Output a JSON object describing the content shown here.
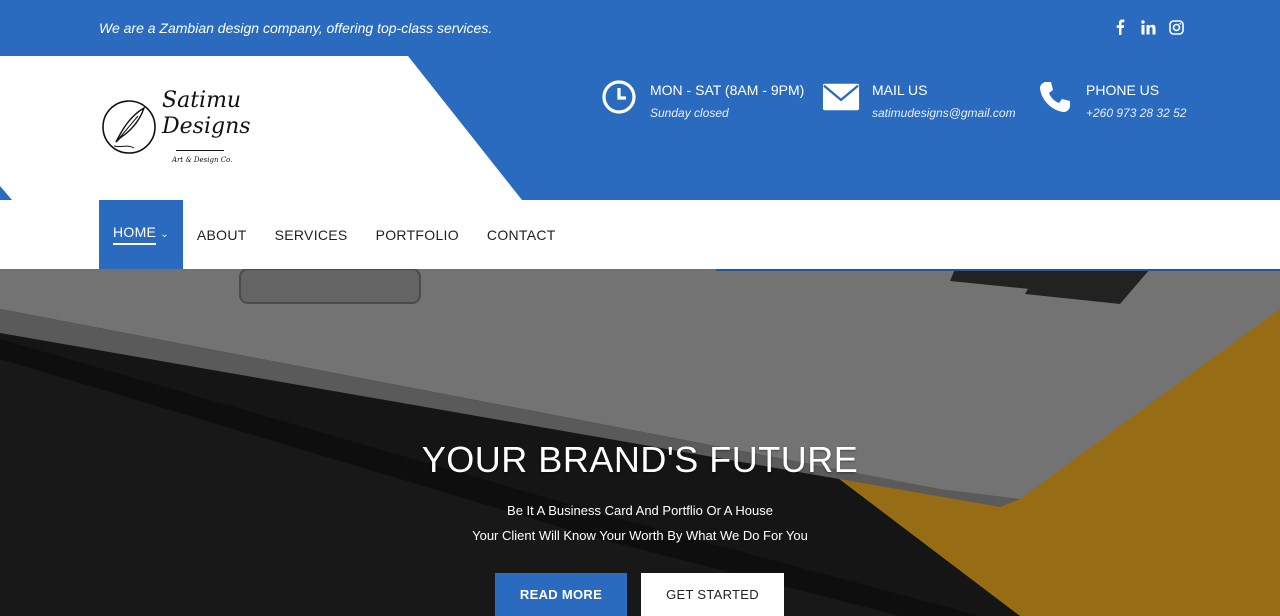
{
  "topbar": {
    "tagline": "We are a Zambian design company, offering top-class services.",
    "socials": [
      "facebook-icon",
      "linkedin-icon",
      "instagram-icon"
    ]
  },
  "logo": {
    "name_line1": "Satimu",
    "name_line2": "Designs",
    "tag": "Art & Design Co."
  },
  "info": [
    {
      "icon": "clock-icon",
      "label": "MON - SAT (8AM - 9PM)",
      "value": "Sunday closed"
    },
    {
      "icon": "mail-icon",
      "label": "MAIL US",
      "value": "satimudesigns@gmail.com"
    },
    {
      "icon": "phone-icon",
      "label": "PHONE US",
      "value": "+260 973 28 32 52"
    }
  ],
  "nav": {
    "items": [
      "HOME",
      "ABOUT",
      "SERVICES",
      "PORTFOLIO",
      "CONTACT"
    ],
    "active": "HOME"
  },
  "hero": {
    "title": "YOUR BRAND'S FUTURE",
    "sub1": "Be It A Business Card And Portflio Or A House",
    "sub2": "Your Client Will Know Your Worth By What We Do For You",
    "primary_button": "READ MORE",
    "secondary_button": "GET STARTED"
  },
  "colors": {
    "brand_blue": "#2a6bbf",
    "accent_yellow": "#c8931a",
    "white": "#ffffff"
  }
}
